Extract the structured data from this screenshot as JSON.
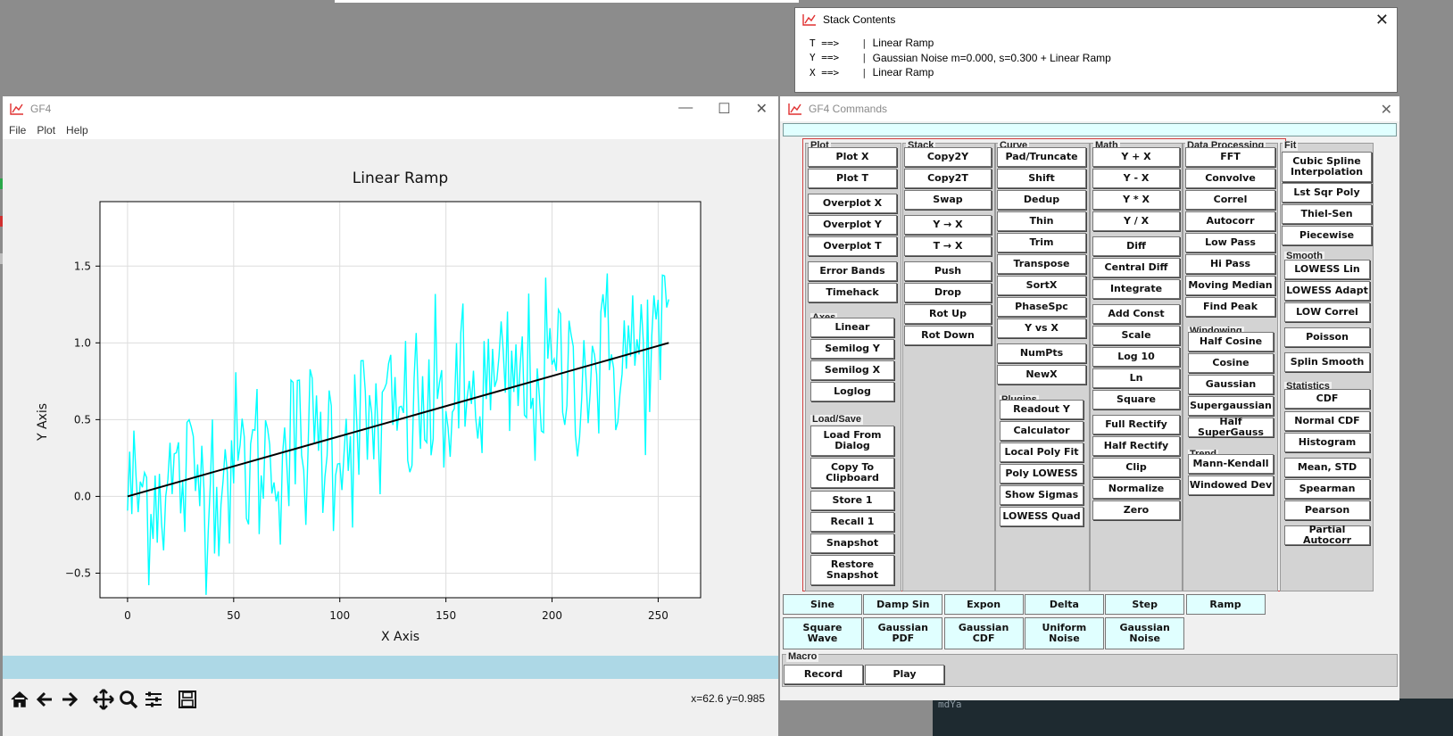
{
  "stack_window": {
    "title": "Stack Contents",
    "rows": [
      {
        "reg": "T ==>",
        "pipe": "|",
        "value": "Linear Ramp"
      },
      {
        "reg": "Y ==>",
        "pipe": "|",
        "value": "Gaussian Noise m=0.000, s=0.300 + Linear Ramp"
      },
      {
        "reg": "X ==>",
        "pipe": "|",
        "value": "Linear Ramp"
      }
    ]
  },
  "plot_window": {
    "title": "GF4",
    "menu": [
      "File",
      "Plot",
      "Help"
    ],
    "coord_readout": "x=62.6 y=0.985",
    "tools": [
      "home-icon",
      "back-arrow-icon",
      "forward-arrow-icon",
      "pan-icon",
      "zoom-icon",
      "configure-icon",
      "save-icon"
    ]
  },
  "chart_data": {
    "type": "line",
    "title": "Linear Ramp",
    "xlabel": "X Axis",
    "ylabel": "Y Axis",
    "xlim": [
      -13,
      270
    ],
    "ylim": [
      -0.66,
      1.92
    ],
    "xticks": [
      0,
      50,
      100,
      150,
      200,
      250
    ],
    "yticks": [
      -0.5,
      0.0,
      0.5,
      1.0,
      1.5
    ],
    "ytick_labels": [
      "−0.5",
      "0.0",
      "0.5",
      "1.0",
      "1.5"
    ],
    "grid": true,
    "series": [
      {
        "color": "#00ffff",
        "x_start": 0,
        "x_step": 1,
        "n": 256,
        "noise_sigma": 0.3,
        "trend": [
          0,
          1.0
        ]
      },
      {
        "color": "#000000",
        "x": [
          0,
          255
        ],
        "y": [
          0.0,
          1.0
        ]
      }
    ]
  },
  "commands_window": {
    "title": "GF4 Commands",
    "groups": {
      "plot": {
        "label": "Plot",
        "buttons": [
          "Plot X",
          "Plot T",
          "Overplot X",
          "Overplot Y",
          "Overplot T",
          "Error Bands",
          "Timehack"
        ]
      },
      "axes": {
        "label": "Axes",
        "buttons": [
          "Linear",
          "Semilog Y",
          "Semilog X",
          "Loglog"
        ]
      },
      "loadsave": {
        "label": "Load/Save",
        "buttons": [
          "Load From\nDialog",
          "Copy To\nClipboard",
          "Store 1",
          "Recall 1",
          "Snapshot",
          "Restore\nSnapshot"
        ]
      },
      "stack": {
        "label": "Stack",
        "buttons": [
          "Copy2Y",
          "Copy2T",
          "Swap",
          "Y → X",
          "T → X",
          "Push",
          "Drop",
          "Rot Up",
          "Rot Down"
        ]
      },
      "curve": {
        "label": "Curve",
        "buttons": [
          "Pad/Truncate",
          "Shift",
          "Dedup",
          "Thin",
          "Trim",
          "Transpose",
          "SortX",
          "PhaseSpc",
          "Y vs X",
          "NumPts",
          "NewX"
        ]
      },
      "plugins": {
        "label": "Plugins",
        "buttons": [
          "Readout Y",
          "Calculator",
          "Local Poly Fit",
          "Poly LOWESS",
          "Show Sigmas",
          "LOWESS Quad"
        ]
      },
      "math": {
        "label": "Math",
        "buttons": [
          "Y + X",
          "Y - X",
          "Y * X",
          "Y / X",
          "Diff",
          "Central Diff",
          "Integrate",
          "Add Const",
          "Scale",
          "Log 10",
          "Ln",
          "Square",
          "Full Rectify",
          "Half Rectify",
          "Clip",
          "Normalize",
          "Zero"
        ]
      },
      "dataproc": {
        "label": "Data Processing",
        "buttons": [
          "FFT",
          "Convolve",
          "Correl",
          "Autocorr",
          "Low Pass",
          "Hi Pass",
          "Moving Median",
          "Find Peak"
        ]
      },
      "windowing": {
        "label": "Windowing",
        "buttons": [
          "Half Cosine",
          "Cosine",
          "Gaussian",
          "Supergaussian",
          "Half SuperGauss"
        ]
      },
      "trend": {
        "label": "Trend",
        "buttons": [
          "Mann-Kendall",
          "Windowed Dev"
        ]
      },
      "fit": {
        "label": "Fit",
        "buttons": [
          "Cubic Spline\nInterpolation",
          "Lst Sqr Poly",
          "Thiel-Sen",
          "Piecewise"
        ]
      },
      "smooth": {
        "label": "Smooth",
        "buttons": [
          "LOWESS Lin",
          "LOWESS Adapt",
          "LOW Correl",
          "Poisson",
          "Splin Smooth"
        ]
      },
      "statistics": {
        "label": "Statistics",
        "buttons": [
          "CDF",
          "Normal CDF",
          "Histogram",
          "Mean, STD",
          "Spearman",
          "Pearson",
          "Partial Autocorr"
        ]
      }
    },
    "generators_row1": [
      "Sine",
      "Damp Sin",
      "Expon",
      "Delta",
      "Step",
      "Ramp"
    ],
    "generators_row2": [
      "Square\nWave",
      "Gaussian\nPDF",
      "Gaussian\nCDF",
      "Uniform\nNoise",
      "Gaussian\nNoise"
    ],
    "macro": {
      "label": "Macro",
      "buttons": [
        "Record",
        "Play"
      ]
    }
  },
  "desktop": {
    "taskbar_snippet": "mdYa"
  },
  "colors": {
    "accent_red": "#e03030",
    "light_blue": "#add8e6",
    "light_cyan": "#e0ffff",
    "cyan_series": "#00ffff"
  }
}
